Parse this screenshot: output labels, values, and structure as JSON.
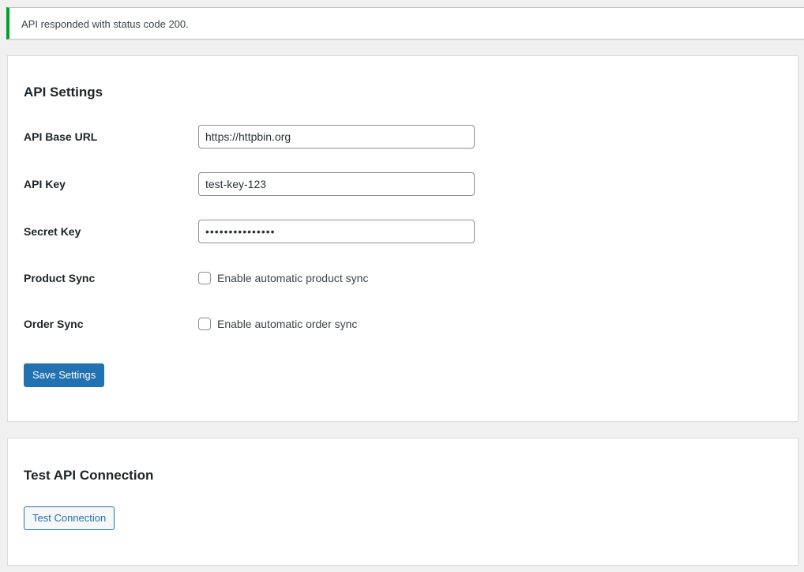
{
  "notice": {
    "message": "API responded with status code 200.",
    "accent_color": "#00a32a"
  },
  "settings": {
    "title": "API Settings",
    "fields": {
      "base_url": {
        "label": "API Base URL",
        "value": "https://httpbin.org"
      },
      "api_key": {
        "label": "API Key",
        "value": "test-key-123"
      },
      "secret_key": {
        "label": "Secret Key",
        "value": "•••••••••••••••"
      }
    },
    "product_sync": {
      "label": "Product Sync",
      "checkbox_label": "Enable automatic product sync",
      "checked": false
    },
    "order_sync": {
      "label": "Order Sync",
      "checkbox_label": "Enable automatic order sync",
      "checked": false
    },
    "save_button": "Save Settings"
  },
  "test": {
    "title": "Test API Connection",
    "button": "Test Connection"
  },
  "colors": {
    "primary": "#2271b1",
    "background": "#f0f0f1",
    "card": "#ffffff"
  }
}
